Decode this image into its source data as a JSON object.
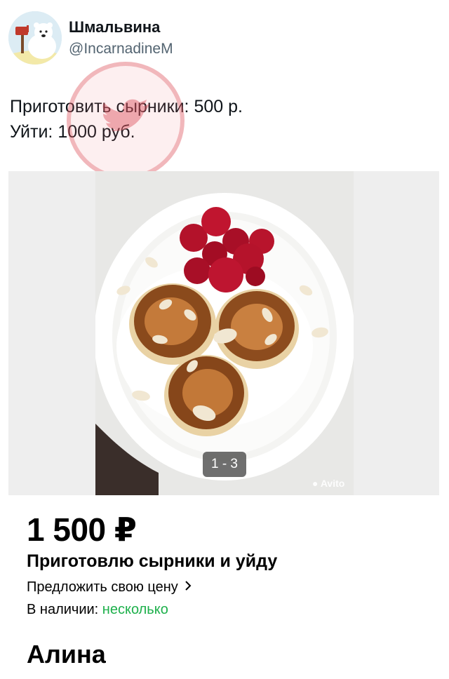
{
  "tweet": {
    "author_name": "Шмальвина",
    "author_handle": "@IncarnadineM",
    "text_lines": [
      "Приготовить сырники: 500 р.",
      "Уйти: 1000 руб."
    ],
    "watermark_icon": "twitter-bird-icon"
  },
  "listing": {
    "photo_counter": "1 - 3",
    "photo_watermark": "Avito",
    "price": "1 500 ₽",
    "title": "Приготовлю сырники и уйду",
    "offer_link": "Предложить свою цену",
    "offer_icon": "chevron-right-icon",
    "stock_label": "В наличии:",
    "stock_value": "несколько",
    "seller_name": "Алина"
  },
  "colors": {
    "stock_green": "#1db04b",
    "watermark_red": "#dc505a",
    "handle_gray": "#536471"
  }
}
